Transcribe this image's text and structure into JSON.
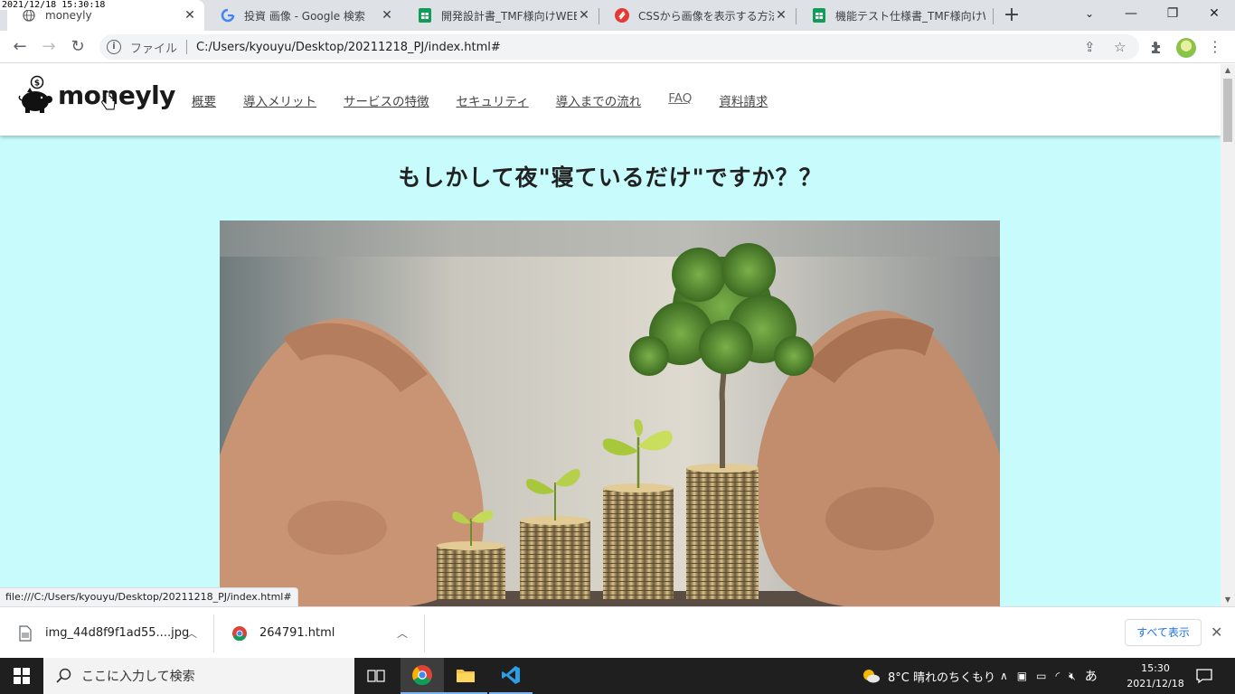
{
  "screenshot_timestamp": "2021/12/18 15:30:18",
  "browser": {
    "tabs": [
      {
        "title": "moneyly",
        "active": true
      },
      {
        "title": "投資 画像 - Google 検索",
        "active": false
      },
      {
        "title": "開発設計書_TMF様向けWEBサ",
        "active": false
      },
      {
        "title": "CSSから画像を表示する方法とは",
        "active": false
      },
      {
        "title": "機能テスト仕様書_TMF様向けW",
        "active": false
      }
    ],
    "omnibox": {
      "scheme_label": "ファイル",
      "url": "C:/Users/kyouyu/Desktop/20211218_PJ/index.html#"
    },
    "status_url": "file:///C:/Users/kyouyu/Desktop/20211218_PJ/index.html#"
  },
  "site": {
    "logo_text": "moneyly",
    "coin_symbol": "$",
    "nav": [
      {
        "label": "概要"
      },
      {
        "label": "導入メリット"
      },
      {
        "label": "サービスの特徴"
      },
      {
        "label": "セキュリティ"
      },
      {
        "label": "導入までの流れ"
      },
      {
        "label": "FAQ"
      },
      {
        "label": "資料請求"
      }
    ],
    "hero_title": "もしかして夜\"寝ているだけ\"ですか？？",
    "background_color": "#c8fcfc"
  },
  "downloads": {
    "items": [
      {
        "name": "img_44d8f9f1ad55....jpg"
      },
      {
        "name": "264791.html"
      }
    ],
    "show_all_label": "すべて表示"
  },
  "taskbar": {
    "search_placeholder": "ここに入力して検索",
    "weather": "8°C  晴れのちくもり",
    "ime": "あ",
    "time": "15:30",
    "date": "2021/12/18"
  }
}
